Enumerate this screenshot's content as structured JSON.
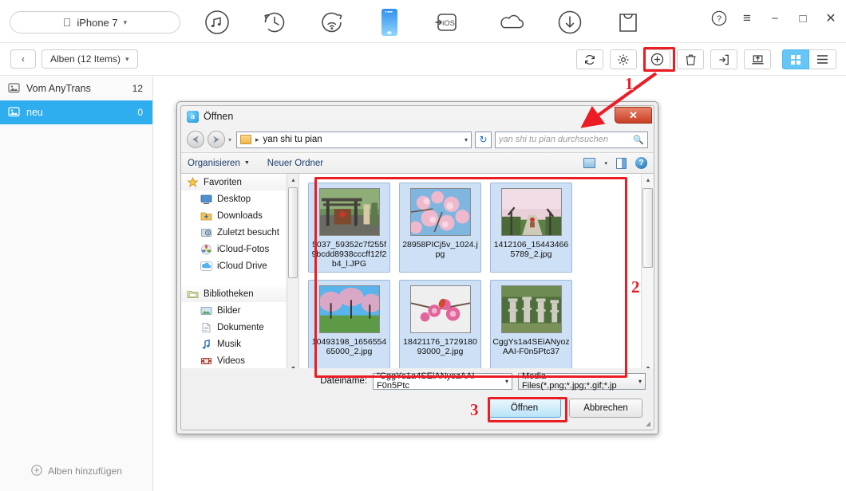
{
  "topbar": {
    "device_label": "iPhone 7",
    "icons": [
      {
        "name": "music-note-icon",
        "title": "Musik"
      },
      {
        "name": "history-clock-icon",
        "title": "Verlauf"
      },
      {
        "name": "airbackup-wifi-icon",
        "title": "AirBackup"
      },
      {
        "name": "iphone-device-icon",
        "title": "Gerät"
      },
      {
        "name": "to-ios-icon",
        "title": "iOS"
      },
      {
        "name": "cloud-icon",
        "title": "Cloud"
      },
      {
        "name": "download-icon",
        "title": "Download"
      },
      {
        "name": "tshirt-icon",
        "title": "App"
      }
    ],
    "help_label": "?",
    "menu_label": "≡",
    "minimize_label": "−",
    "maximize_label": "□",
    "close_label": "✕"
  },
  "subbar": {
    "back_label": "‹",
    "album_label": "Alben (12 Items)",
    "caret": "⌄",
    "actions": [
      {
        "name": "refresh-button",
        "label": "refresh-icon"
      },
      {
        "name": "settings-button",
        "label": "gear-icon"
      },
      {
        "name": "add-button",
        "label": "plus-circle-icon"
      },
      {
        "name": "delete-button",
        "label": "trash-icon"
      },
      {
        "name": "export-to-device-button",
        "label": "export-icon"
      },
      {
        "name": "send-to-computer-button",
        "label": "to-computer-icon"
      }
    ],
    "view_grid": "grid-view-icon",
    "view_list": "list-view-icon"
  },
  "sidebar": {
    "items": [
      {
        "label": "Vom AnyTrans",
        "count": "12",
        "selected": false
      },
      {
        "label": "neu",
        "count": "0",
        "selected": true
      }
    ],
    "add_album_label": "Alben hinzufügen",
    "add_album_icon": "plus-circle-icon"
  },
  "dialog": {
    "title": "Öffnen",
    "app_icon_letter": "a",
    "close_label": "✕",
    "nav_back": "⮜",
    "nav_forward": "⮞",
    "nav_dropdown": "▾",
    "address_path": "yan shi tu pian",
    "address_sep": "▸",
    "address_caret": "▾",
    "refresh_label": "↻",
    "search_placeholder": "yan shi tu pian durchsuchen",
    "search_icon": "magnifier-icon",
    "cmd_organize": "Organisieren",
    "cmd_new_folder": "Neuer Ordner",
    "cmd_view_icon": "view-layout-icon",
    "cmd_view_caret": "▾",
    "cmd_pane_icon": "preview-pane-icon",
    "cmd_help_icon": "help-icon",
    "nav_pane": [
      {
        "label": "Favoriten",
        "type": "head",
        "icon": "star-icon",
        "color": "#f5c01e"
      },
      {
        "label": "Desktop",
        "type": "child",
        "icon": "desktop-icon",
        "color": "#3d7fc1"
      },
      {
        "label": "Downloads",
        "type": "child",
        "icon": "downloads-folder-icon",
        "color": "#edb547"
      },
      {
        "label": "Zuletzt besucht",
        "type": "child",
        "icon": "recent-places-icon",
        "color": "#9fb3c6"
      },
      {
        "label": "iCloud-Fotos",
        "type": "child",
        "icon": "icloud-photos-icon",
        "color": "#e8625c"
      },
      {
        "label": "iCloud Drive",
        "type": "child",
        "icon": "icloud-drive-icon",
        "color": "#4fa7e8"
      },
      {
        "label": "Bibliotheken",
        "type": "head",
        "icon": "libraries-icon",
        "color": "#d4b26a"
      },
      {
        "label": "Bilder",
        "type": "child",
        "icon": "pictures-icon",
        "color": "#5fa8d8"
      },
      {
        "label": "Dokumente",
        "type": "child",
        "icon": "documents-icon",
        "color": "#dfe6ee"
      },
      {
        "label": "Musik",
        "type": "child",
        "icon": "music-icon",
        "color": "#2f6fb5"
      },
      {
        "label": "Videos",
        "type": "child",
        "icon": "videos-icon",
        "color": "#c04a3a"
      }
    ],
    "files": [
      {
        "name": "5037_59352c7f255f9bcdd8938cccff12f2b4_l.JPG",
        "selected": true,
        "thumb": "torii-gate"
      },
      {
        "name": "28958PICj5v_1024.jpg",
        "selected": true,
        "thumb": "blossom-sky"
      },
      {
        "name": "1412106_154434665789_2.jpg",
        "selected": true,
        "thumb": "blossom-path"
      },
      {
        "name": "10493198_165655465000_2.jpg",
        "selected": true,
        "thumb": "blossom-park"
      },
      {
        "name": "18421176_172918093000_2.jpg",
        "selected": true,
        "thumb": "blossom-branch"
      },
      {
        "name": "CggYs1a4SEiANyozAAI-F0n5Ptc37",
        "selected": true,
        "thumb": "stone-lanterns"
      }
    ],
    "filename_label": "Dateiname:",
    "filename_value": "\"CggYs1a4SEiANyozAAI-F0n5Ptc",
    "filename_caret": "▾",
    "filter_value": "Media Files(*.png;*.jpg;*.gif;*.jp",
    "filter_caret": "▾",
    "open_button": "Öffnen",
    "cancel_button": "Abbrechen",
    "resize_grip": "resize-grip-icon"
  },
  "annotations": {
    "marker_1": "1",
    "marker_2": "2",
    "marker_3": "3",
    "accent_red": "#ec1c24"
  }
}
